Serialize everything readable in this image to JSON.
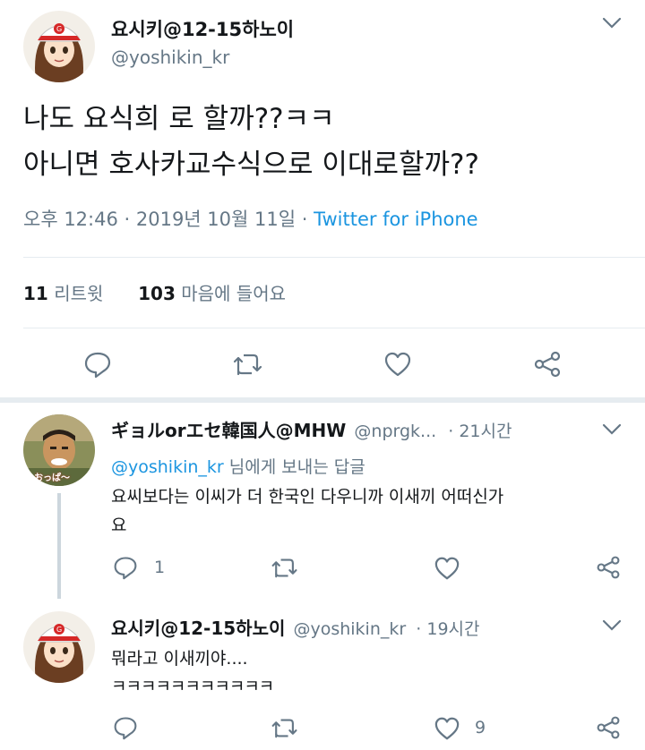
{
  "main_tweet": {
    "display_name": "요시키@12-15하노이",
    "handle": "@yoshikin_kr",
    "text_line1": "나도 요식희 로 할까??ㅋㅋ",
    "text_line2": "아니면 호사카교수식으로 이대로할까??",
    "time": "오후 12:46 · 2019년 10월 11일 ·",
    "source": "Twitter for iPhone",
    "retweet_count": "11",
    "retweet_label": "리트윗",
    "like_count": "103",
    "like_label": "마음에 들어요"
  },
  "reply1": {
    "display_name": "ギョルorエセ韓国人@MHW",
    "handle": "@nprgk...",
    "time": "· 21시간",
    "reply_to_handle": "@yoshikin_kr",
    "reply_to_suffix": "님에게 보내는 답글",
    "text_line1": "요씨보다는 이씨가 더 한국인 다우니까 이새끼 어떠신가",
    "text_line2": "요",
    "reply_count": "1",
    "avatar_caption": "おっぱ〜"
  },
  "reply2": {
    "display_name": "요시키@12-15하노이",
    "handle": "@yoshikin_kr",
    "time": "· 19시간",
    "text_line1": "뭐라고 이새끼야....",
    "text_line2": "ㅋㅋㅋㅋㅋㅋㅋㅋㅋㅋㅋ",
    "like_count": "9"
  },
  "colors": {
    "text": "#14171a",
    "muted": "#657786",
    "link": "#1b95e0",
    "divider": "#e6ecf0"
  }
}
